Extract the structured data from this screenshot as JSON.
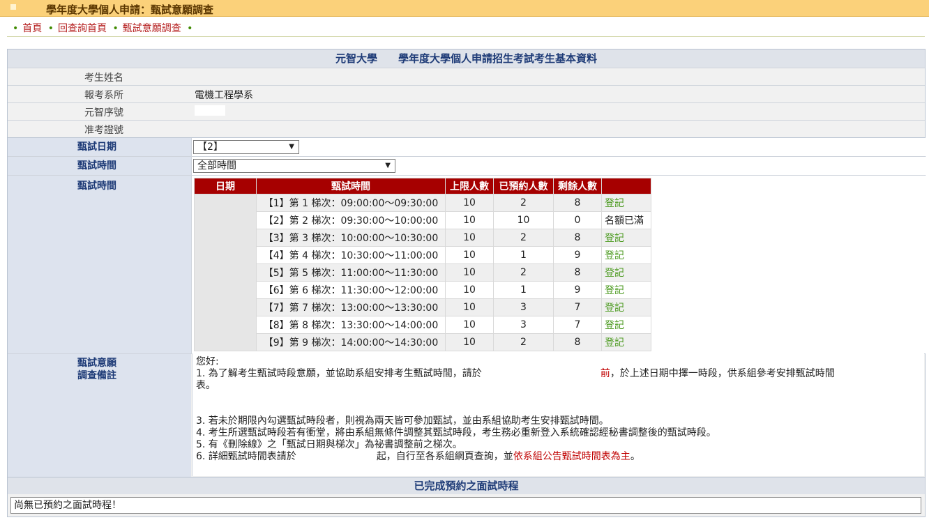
{
  "header": {
    "title": "學年度大學個人申請：甄試意願調查"
  },
  "breadcrumb": {
    "items": [
      "首頁",
      "回查詢首頁",
      "甄試意願調查"
    ]
  },
  "form": {
    "heading": "元智大學　　學年度大學個人申請招生考試考生基本資料",
    "rows": [
      {
        "label": "考生姓名",
        "value": ""
      },
      {
        "label": "報考系所",
        "value": "電機工程學系"
      },
      {
        "label": "元智序號",
        "value": ""
      },
      {
        "label": "准考證號",
        "value": ""
      }
    ],
    "date": {
      "label": "甄試日期",
      "selected": "【2】"
    },
    "time_filter": {
      "label": "甄試時間",
      "selected": "全部時間"
    },
    "schedule_label": "甄試時間",
    "table": {
      "headers": [
        "日期",
        "甄試時間",
        "上限人數",
        "已預約人數",
        "剩餘人數",
        ""
      ],
      "rows": [
        {
          "slot": "【1】第 1 梯次：09:00:00～09:30:00",
          "limit": "10",
          "reserved": "2",
          "remain": "8",
          "action": "登記"
        },
        {
          "slot": "【2】第 2 梯次：09:30:00～10:00:00",
          "limit": "10",
          "reserved": "10",
          "remain": "0",
          "action": "名額已滿"
        },
        {
          "slot": "【3】第 3 梯次：10:00:00～10:30:00",
          "limit": "10",
          "reserved": "2",
          "remain": "8",
          "action": "登記"
        },
        {
          "slot": "【4】第 4 梯次：10:30:00～11:00:00",
          "limit": "10",
          "reserved": "1",
          "remain": "9",
          "action": "登記"
        },
        {
          "slot": "【5】第 5 梯次：11:00:00～11:30:00",
          "limit": "10",
          "reserved": "2",
          "remain": "8",
          "action": "登記"
        },
        {
          "slot": "【6】第 6 梯次：11:30:00～12:00:00",
          "limit": "10",
          "reserved": "1",
          "remain": "9",
          "action": "登記"
        },
        {
          "slot": "【7】第 7 梯次：13:00:00～13:30:00",
          "limit": "10",
          "reserved": "3",
          "remain": "7",
          "action": "登記"
        },
        {
          "slot": "【8】第 8 梯次：13:30:00～14:00:00",
          "limit": "10",
          "reserved": "3",
          "remain": "7",
          "action": "登記"
        },
        {
          "slot": "【9】第 9 梯次：14:00:00～14:30:00",
          "limit": "10",
          "reserved": "2",
          "remain": "8",
          "action": "登記"
        }
      ]
    }
  },
  "notes": {
    "label_line1": "甄試意願",
    "label_line2": "調查備註",
    "greeting": "您好:",
    "line1_a": "1. 為了解考生甄試時段意願，並協助系組安排考生甄試時間，請於",
    "line1_red": "前",
    "line1_b": "，於上述日期中擇一時段，供系組參考安排甄試時間",
    "line1_c": "表。",
    "line3": "3. 若未於期限內勾選甄試時段者，則視為兩天皆可參加甄試，並由系組協助考生安排甄試時間。",
    "line4": "4. 考生所選甄試時段若有衝堂，將由系組無條件調整其甄試時段，考生務必重新登入系統確認經秘書調整後的甄試時段。",
    "line5": "5. 有《刪除線》之「甄試日期與梯次」為祕書調整前之梯次。",
    "line6_a": "6. 詳細甄試時間表請於",
    "line6_b": "起，自行至各系組網頁查詢，並",
    "line6_red": "依系組公告甄試時間表為主",
    "line6_c": "。"
  },
  "booked": {
    "heading": "已完成預約之面試時程",
    "message": "尚無已預約之面試時程！"
  }
}
